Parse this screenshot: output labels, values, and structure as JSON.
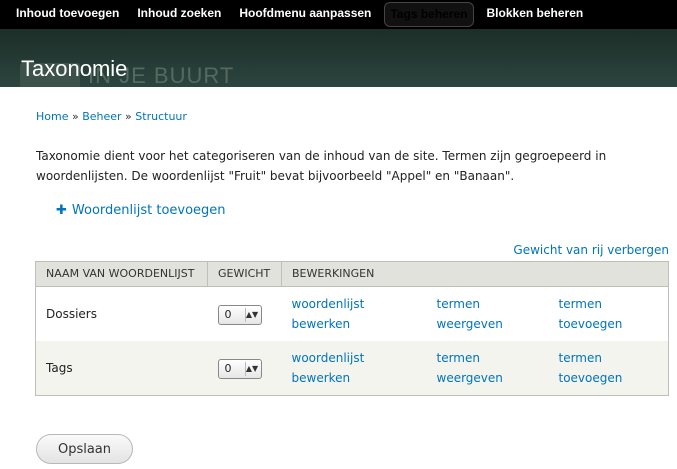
{
  "toolbar": {
    "items": [
      {
        "label": "Inhoud toevoegen"
      },
      {
        "label": "Inhoud zoeken"
      },
      {
        "label": "Hoofdmenu aanpassen"
      },
      {
        "label": "Tags beheren"
      },
      {
        "label": "Blokken beheren"
      }
    ],
    "active_index": 3
  },
  "header": {
    "title": "Taxonomie",
    "background_text": "IN JE BUURT"
  },
  "breadcrumb": {
    "home": "Home",
    "sep1": " » ",
    "beheer": "Beheer",
    "sep2": " » ",
    "structuur": "Structuur"
  },
  "description": "Taxonomie dient voor het categoriseren van de inhoud van de site. Termen zijn gegroepeerd in woordenlijsten. De woordenlijst \"Fruit\" bevat bijvoorbeeld \"Appel\" en \"Banaan\".",
  "add_vocabulary": {
    "icon": "plus-icon",
    "label": "Woordenlijst toevoegen"
  },
  "weight_toggle": "Gewicht van rij verbergen",
  "table": {
    "headers": {
      "name": "NAAM VAN WOORDENLIJST",
      "weight": "GEWICHT",
      "operations": "BEWERKINGEN"
    },
    "rows": [
      {
        "name": "Dossiers",
        "weight": "0",
        "edit": "woordenlijst bewerken",
        "list": "termen weergeven",
        "add": "termen toevoegen"
      },
      {
        "name": "Tags",
        "weight": "0",
        "edit": "woordenlijst bewerken",
        "list": "termen weergeven",
        "add": "termen toevoegen"
      }
    ]
  },
  "save_button": "Opslaan",
  "colors": {
    "link": "#0074bd",
    "toolbar_bg": "#000000",
    "header_bg": "#253a34",
    "table_header_bg": "#e1e2dc"
  }
}
